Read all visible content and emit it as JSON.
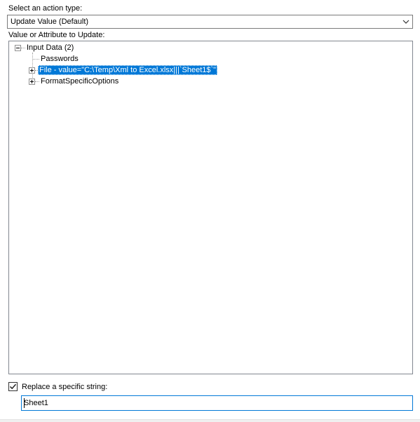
{
  "action": {
    "label": "Select an action type:",
    "selected": "Update Value (Default)",
    "arrow_icon": "chevron-down-icon"
  },
  "tree": {
    "label": "Value or Attribute to Update:",
    "root": {
      "label": "Input Data (2)",
      "expanded": true,
      "children": [
        {
          "label": "Passwords",
          "has_children": false
        },
        {
          "label": "File - value=\"C:\\Temp\\Xml to Excel.xlsx|||`Sheet1$`\"",
          "has_children": true,
          "selected": true
        },
        {
          "label": "FormatSpecificOptions",
          "has_children": true
        }
      ]
    }
  },
  "replace": {
    "checked": true,
    "label": "Replace a specific string:",
    "value": "Sheet1"
  },
  "colors": {
    "selection": "#0078d7",
    "focus_border": "#0078d7"
  }
}
